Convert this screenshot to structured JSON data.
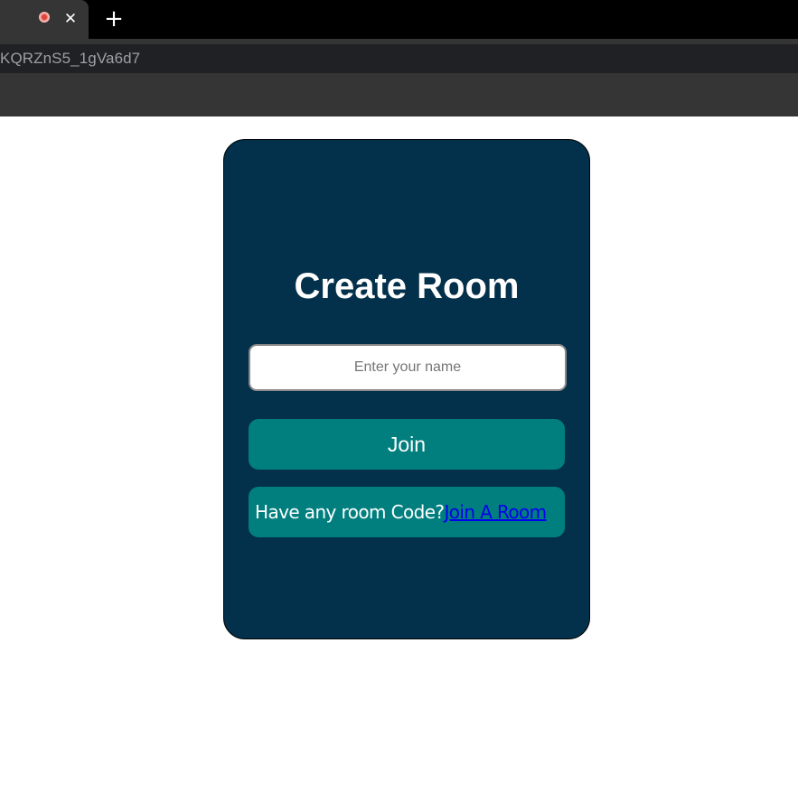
{
  "browser": {
    "tab_close_glyph": "✕",
    "new_tab_glyph": "+",
    "url": "KQRZnS5_1gVa6d7",
    "icons": {
      "recording": "recording-indicator-icon",
      "close": "close-icon",
      "new_tab": "plus-icon"
    }
  },
  "card": {
    "title": "Create Room",
    "name_input": {
      "value": "",
      "placeholder": "Enter your name"
    },
    "join_button_label": "Join",
    "room_code_prompt": "Have any room Code?",
    "join_room_link": "Join A Room"
  },
  "colors": {
    "card_background": "#03304a",
    "accent_teal": "#017f7f",
    "link": "#0000ee"
  }
}
